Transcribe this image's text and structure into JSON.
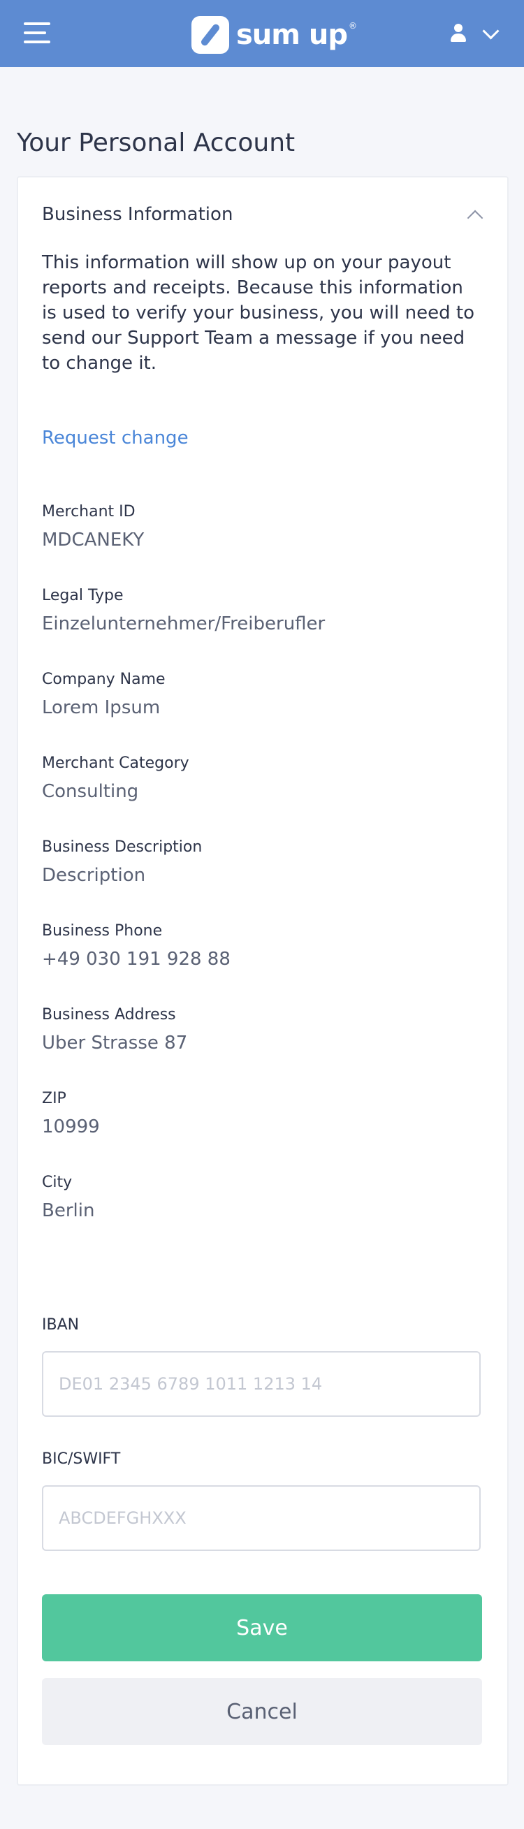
{
  "header": {
    "logo_text": "sum up",
    "logo_reg": "®",
    "menu_icon": "hamburger-menu-icon",
    "user_icon": "user-icon",
    "chevron_icon": "chevron-down-icon",
    "background_color": "#5d8bd2"
  },
  "page": {
    "title": "Your Personal Account"
  },
  "business_info": {
    "section_title": "Business Information",
    "intro": "This information will show up on your payout reports and receipts. Because this information is used to verify your business, you will need to send our Support Team a message if you need to change it.",
    "request_change_label": "Request change",
    "fields": [
      {
        "label": "Merchant ID",
        "value": "MDCANEKY"
      },
      {
        "label": "Legal Type",
        "value": "Einzelunternehmer/Freiberufler"
      },
      {
        "label": "Company Name",
        "value": "Lorem Ipsum"
      },
      {
        "label": "Merchant Category",
        "value": "Consulting"
      },
      {
        "label": "Business Description",
        "value": "Description"
      },
      {
        "label": "Business Phone",
        "value": "+49 030 191 928 88"
      },
      {
        "label": "Business Address",
        "value": "Uber Strasse 87"
      },
      {
        "label": "ZIP",
        "value": "10999"
      },
      {
        "label": "City",
        "value": "Berlin"
      }
    ]
  },
  "bank": {
    "iban_label": "IBAN",
    "iban_placeholder": "DE01 2345 6789 1011 1213 14",
    "iban_value": "",
    "bic_label": "BIC/SWIFT",
    "bic_placeholder": "ABCDEFGHXXX",
    "bic_value": ""
  },
  "actions": {
    "save_label": "Save",
    "cancel_label": "Cancel",
    "save_color": "#52c79d"
  }
}
